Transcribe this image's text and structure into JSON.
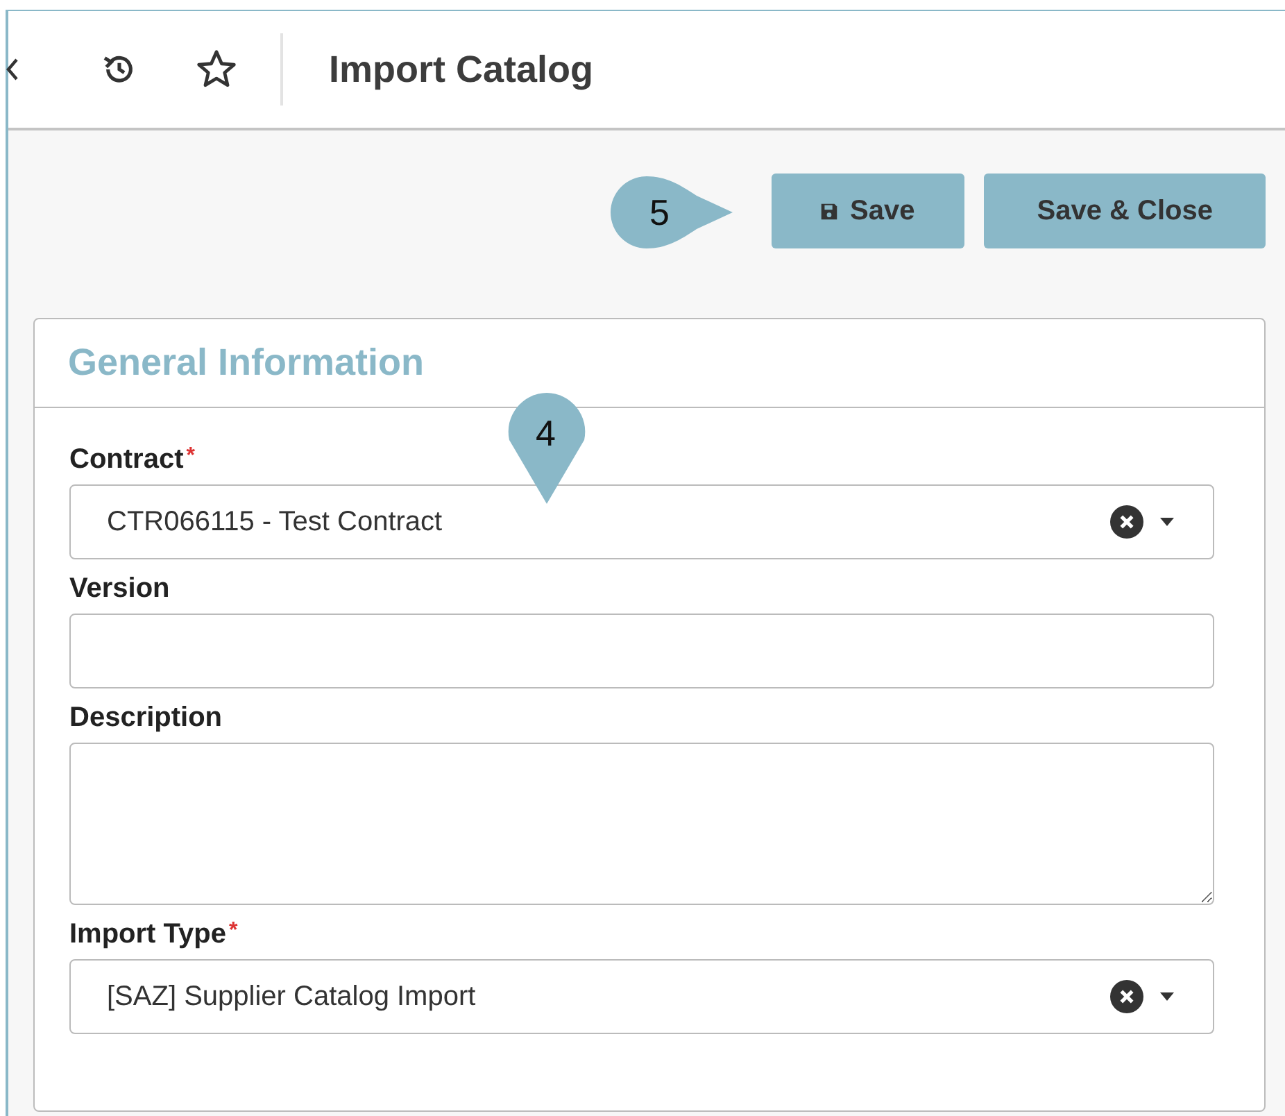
{
  "header": {
    "title": "Import Catalog"
  },
  "buttons": [
    {
      "label": "Save",
      "icon": true
    },
    {
      "label": "Save & Close",
      "icon": false
    }
  ],
  "callouts": [
    {
      "text": "5",
      "kind": "left"
    },
    {
      "text": "4",
      "kind": "pin"
    }
  ],
  "section": {
    "title": "General Information"
  },
  "fields": [
    {
      "label": "Contract",
      "required_mark": "*",
      "kind": "select",
      "value": "CTR066115 - Test Contract"
    },
    {
      "label": "Version",
      "kind": "text"
    },
    {
      "label": "Description",
      "kind": "textarea"
    },
    {
      "label": "Import Type",
      "required_mark": "*",
      "kind": "select",
      "value": "[SAZ] Supplier Catalog Import"
    }
  ]
}
